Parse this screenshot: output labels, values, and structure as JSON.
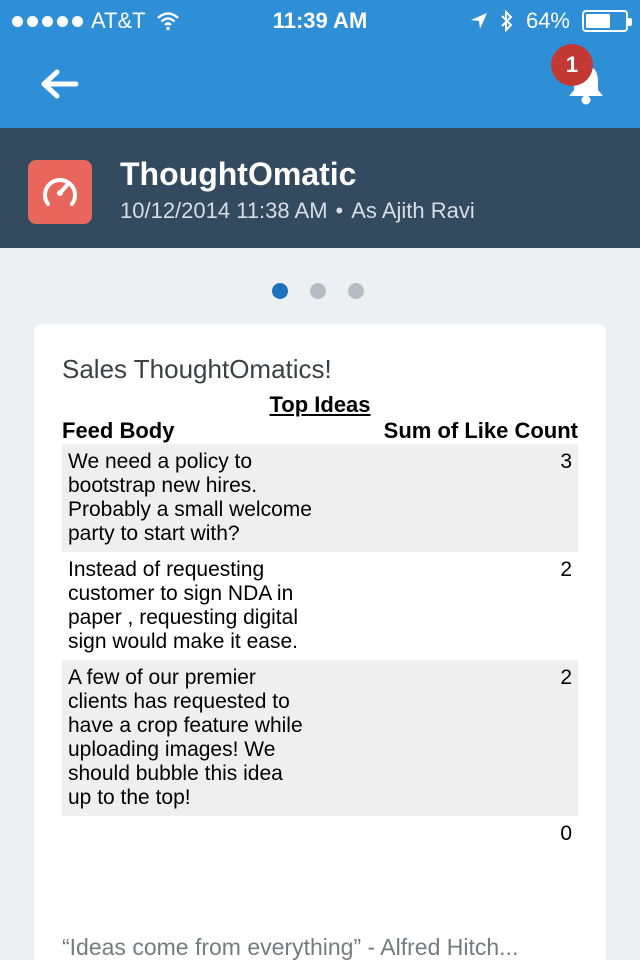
{
  "status_bar": {
    "carrier": "AT&T",
    "time": "11:39 AM",
    "battery": "64%",
    "battery_level": 0.64
  },
  "nav": {
    "notification_count": "1"
  },
  "header": {
    "title": "ThoughtOmatic",
    "timestamp": "10/12/2014 11:38 AM",
    "separator": "•",
    "author": "As Ajith Ravi"
  },
  "pager": {
    "pages": 3,
    "active": 0
  },
  "card": {
    "title": "Sales ThoughtOmatics!",
    "report_title": "Top Ideas",
    "columns": {
      "body": "Feed Body",
      "count": "Sum of Like Count"
    },
    "rows": [
      {
        "text": "We need a policy to bootstrap new hires. Probably a small welcome party to start with?",
        "count": "3"
      },
      {
        "text": "Instead of requesting customer to sign NDA in paper , requesting digital sign would make it ease.",
        "count": "2"
      },
      {
        "text": "A few of our premier clients has requested to have a crop feature while uploading images! We should bubble this idea up to the top!",
        "count": "2"
      },
      {
        "text": "",
        "count": "0"
      }
    ],
    "quote": "“Ideas come from everything” - Alfred Hitch..."
  },
  "colors": {
    "nav_blue": "#2e8fd6",
    "header_navy": "#344a5e",
    "app_icon": "#e8665c",
    "badge_red": "#c23934",
    "pager_active": "#1e72bd"
  },
  "icons": [
    "signal-dots-icon",
    "wifi-icon",
    "location-arrow-icon",
    "bluetooth-icon",
    "battery-icon",
    "back-arrow-icon",
    "bell-icon",
    "speedometer-icon"
  ]
}
